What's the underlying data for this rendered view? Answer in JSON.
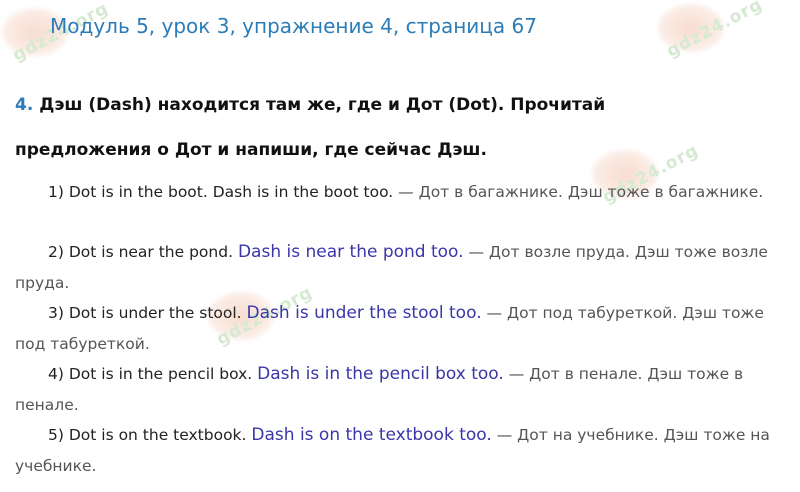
{
  "watermark": {
    "text": "gdz24.org"
  },
  "heading": {
    "title": "Модуль 5, урок 3, упражнение 4, страница 67"
  },
  "task": {
    "number": "4.",
    "line1": "Дэш (Dash) находится там же, где и Дот (Dot). Прочитай",
    "line2": "предложения о Дот и напиши, где сейчас Дэш."
  },
  "items": [
    {
      "sentence": "1) Dot is in the boot. Dash is in the boot too.",
      "answer": "",
      "dash": " — ",
      "translation": "Дот в багажнике. Дэш тоже в багажнике."
    },
    {
      "sentence": "2) Dot is near the pond.",
      "answer": "Dash is near the pond too.",
      "dash": " — ",
      "translation": "Дот возле пруда. Дэш тоже возле пруда."
    },
    {
      "sentence": "3) Dot is under the stool.",
      "answer": "Dash is under the stool too.",
      "dash": " — ",
      "translation": "Дот под табуреткой. Дэш тоже под табуреткой."
    },
    {
      "sentence": "4) Dot is in the pencil box.",
      "answer": "Dash is in the pencil box too.",
      "dash": " — ",
      "translation": "Дот в пенале. Дэш тоже в пенале."
    },
    {
      "sentence": "5) Dot is on the textbook.",
      "answer": "Dash is on the textbook too.",
      "dash": " — ",
      "translation": "Дот на учебнике. Дэш тоже на учебнике."
    }
  ]
}
